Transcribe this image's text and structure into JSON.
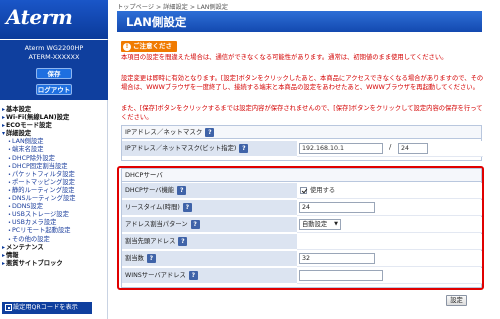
{
  "sidebar": {
    "logo": "Aterm",
    "model_line1": "Aterm  WG2200HP",
    "model_line2": "ATERM-XXXXXX",
    "save_label": "保存",
    "logout_label": "ログアウト",
    "menu": [
      {
        "label": "基本設定",
        "level": "top"
      },
      {
        "label": "Wi-Fi(無線LAN)設定",
        "level": "top"
      },
      {
        "label": "ECOモード設定",
        "level": "top"
      },
      {
        "label": "詳細設定",
        "level": "top"
      },
      {
        "label": "LAN側設定",
        "level": "sub"
      },
      {
        "label": "端末名設定",
        "level": "sub"
      },
      {
        "label": "DHCP除外設定",
        "level": "sub"
      },
      {
        "label": "DHCP固定割当設定",
        "level": "sub"
      },
      {
        "label": "パケットフィルタ設定",
        "level": "sub"
      },
      {
        "label": "ポートマッピング設定",
        "level": "sub"
      },
      {
        "label": "静的ルーティング設定",
        "level": "sub"
      },
      {
        "label": "DNSルーティング設定",
        "level": "sub"
      },
      {
        "label": "DDNS設定",
        "level": "sub"
      },
      {
        "label": "USBストレージ設定",
        "level": "sub"
      },
      {
        "label": "USBカメラ設定",
        "level": "sub"
      },
      {
        "label": "PCリモート起動設定",
        "level": "sub"
      },
      {
        "label": "その他の設定",
        "level": "sub"
      },
      {
        "label": "メンテナンス",
        "level": "top"
      },
      {
        "label": "情報",
        "level": "top"
      },
      {
        "label": "悪質サイトブロック",
        "level": "top"
      }
    ],
    "qr_label": "設定用QRコードを表示"
  },
  "main": {
    "breadcrumb": "トップページ > 詳細設定 > LAN側設定",
    "title": "LAN側設定",
    "notice_title": "ご注意ください",
    "notice1": "本項目の設定を間違えた場合は、通信ができなくなる可能性があります。通常は、初期値のまま使用してください。",
    "notice2": "設定変更は即時に有効となります。[設定]ボタンをクリックしたあと、本商品にアクセスできなくなる場合がありますので、その場合は、WWWブラウザを一度終了し、接続する端末と本商品の設定をあわせたあと、WWWブラウザを再起動してください。",
    "notice3": "また、[保存]ボタンをクリックするまでは設定内容が保存されませんので、[保存]ボタンをクリックして設定内容の保存を行ってください。",
    "ip_section_title": "IPアドレス／ネットマスク",
    "ip_label": "IPアドレス／ネットマスク(ビット指定)",
    "ip_value": "192.168.10.1",
    "ip_slash": "/",
    "mask_value": "24",
    "dhcp_section_title": "DHCPサーバ",
    "dhcp_function_label": "DHCPサーバ機能",
    "dhcp_function_value": "使用する",
    "lease_label": "リースタイム(時間)",
    "lease_value": "24",
    "assign_pattern_label": "アドレス割当パターン",
    "assign_pattern_value": "自動設定",
    "assign_start_label": "割当先頭アドレス",
    "count_label": "割当数",
    "count_value": "32",
    "wins_label": "WINSサーバアドレス",
    "wins_value": "",
    "help": "?",
    "apply_label": "設定"
  },
  "colors": {
    "header_blue": "#1349b0",
    "sidebar_blue": "#0f3f9e",
    "notice_red": "#d40000",
    "notice_orange": "#f07a00",
    "highlight_red": "#e00000",
    "label_bg": "#dce4f1"
  }
}
